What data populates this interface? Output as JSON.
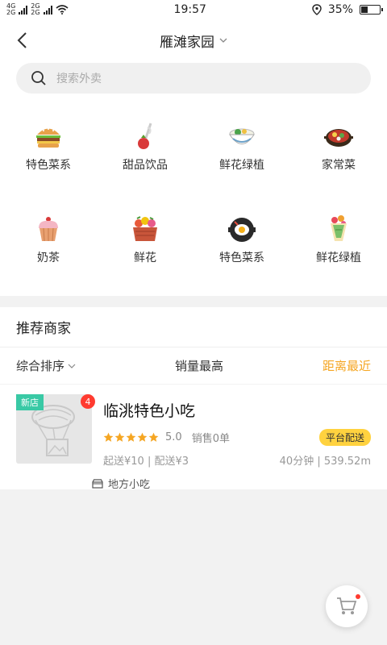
{
  "status_bar": {
    "signal_left_top": "4G",
    "signal_left_bottom": "2G",
    "signal_right_top": "2G",
    "signal_right_bottom": "2G",
    "time": "19:57",
    "battery_percent": "35%",
    "battery_level": 0.35,
    "icons": [
      "signal-icon",
      "wifi-icon",
      "location-icon",
      "battery-icon"
    ]
  },
  "nav": {
    "title": "雁滩家园",
    "back_icon": "back-arrow-icon",
    "dropdown_icon": "chevron-down-icon"
  },
  "search": {
    "placeholder": "搜索外卖",
    "icon": "search-icon"
  },
  "categories": [
    {
      "label": "特色菜系",
      "icon": "burger-icon"
    },
    {
      "label": "甜品饮品",
      "icon": "dessert-icon"
    },
    {
      "label": "鲜花绿植",
      "icon": "noodle-bowl-icon"
    },
    {
      "label": "家常菜",
      "icon": "hotpot-icon"
    },
    {
      "label": "奶茶",
      "icon": "cupcake-icon"
    },
    {
      "label": "鲜花",
      "icon": "flower-basket-icon"
    },
    {
      "label": "特色菜系",
      "icon": "frying-pan-icon"
    },
    {
      "label": "鲜花绿植",
      "icon": "bouquet-icon"
    }
  ],
  "recommend": {
    "title": "推荐商家",
    "sort": {
      "combined": "综合排序",
      "sales": "销量最高",
      "distance": "距离最近"
    }
  },
  "store": {
    "tag": "新店",
    "badge_count": "4",
    "name": "临洮特色小吃",
    "rating": "5.0",
    "rating_value": 5,
    "sales": "销售0单",
    "delivery_tag": "平台配送",
    "min_fee": "起送¥10 | 配送¥3",
    "time_distance": "40分钟 | 539.52m",
    "category": "地方小吃"
  },
  "colors": {
    "accent": "#f5a623",
    "new_tag": "#39c9a5",
    "badge": "#ff3b30",
    "delivery_tag": "#ffd23f",
    "star": "#f5a623"
  },
  "cart": {
    "icon": "cart-icon"
  }
}
